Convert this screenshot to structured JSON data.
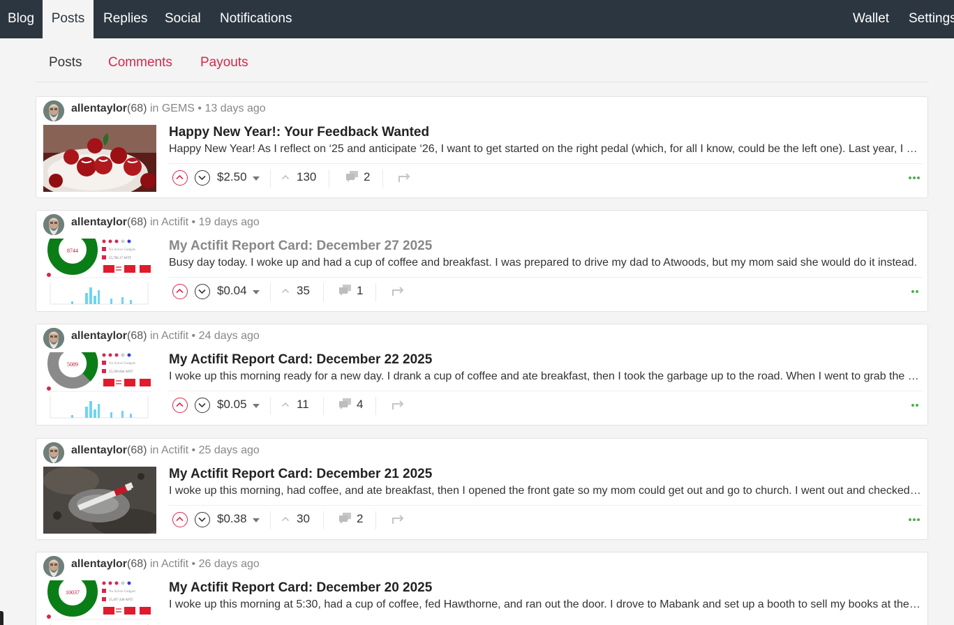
{
  "topnav": {
    "left": [
      "Blog",
      "Posts",
      "Replies",
      "Social",
      "Notifications"
    ],
    "right": [
      "Wallet",
      "Settings"
    ],
    "active": "Posts"
  },
  "subnav": {
    "tabs": [
      "Posts",
      "Comments",
      "Payouts"
    ],
    "active": "Posts"
  },
  "posts": [
    {
      "author": "allentaylor",
      "rep": "(68)",
      "in": "in",
      "community": "GEMS",
      "age": "13 days ago",
      "title": "Happy New Year!: Your Feedback Wanted",
      "excerpt": "Happy New Year! As I reflect on ‘25 and anticipate ‘26, I want to get started on the right pedal (which, for all I know, could be the left one). Last year, I had a lot of fun creating content and sharing it with you.",
      "payout": "$2.50",
      "votes": "130",
      "comments": "2",
      "thumb": "cherries",
      "visited": false
    },
    {
      "author": "allentaylor",
      "rep": "(68)",
      "in": "in",
      "community": "Actifit",
      "age": "19 days ago",
      "title": "My Actifit Report Card: December 27 2025",
      "excerpt": "Busy day today. I woke up and had a cup of coffee and breakfast. I was prepared to drive my dad to Atwoods, but my mom said she would do it instead.",
      "payout": "$0.04",
      "votes": "35",
      "comments": "1",
      "thumb": "actifit",
      "steps": "8744",
      "afit": "25,706.17 AFIT",
      "visited": true
    },
    {
      "author": "allentaylor",
      "rep": "(68)",
      "in": "in",
      "community": "Actifit",
      "age": "24 days ago",
      "title": "My Actifit Report Card: December 22 2025",
      "excerpt": "I woke up this morning ready for a new day. I drank a cup of coffee and ate breakfast, then I took the garbage up to the road. When I went to grab the mail, I noticed something.",
      "payout": "$0.05",
      "votes": "11",
      "comments": "4",
      "thumb": "actifit-grey",
      "steps": "5089",
      "afit": "25,596.684 AFIT",
      "visited": false
    },
    {
      "author": "allentaylor",
      "rep": "(68)",
      "in": "in",
      "community": "Actifit",
      "age": "25 days ago",
      "title": "My Actifit Report Card: December 21 2025",
      "excerpt": "I woke up this morning, had coffee, and ate breakfast, then I opened the front gate so my mom could get out and go to church. I went out and checked on the water line.",
      "payout": "$0.38",
      "votes": "30",
      "comments": "2",
      "thumb": "pipe",
      "visited": false
    },
    {
      "author": "allentaylor",
      "rep": "(68)",
      "in": "in",
      "community": "Actifit",
      "age": "26 days ago",
      "title": "My Actifit Report Card: December 20 2025",
      "excerpt": "I woke up this morning at 5:30, had a cup of coffee, fed Hawthorne, and ran out the door. I drove to Mabank and set up a booth to sell my books at the market.",
      "payout": "",
      "votes": "",
      "comments": "",
      "thumb": "actifit",
      "steps": "10037",
      "afit": "25,497.448 AFIT",
      "visited": false
    }
  ],
  "actifit_labels": {
    "no_gadgets": "No Active Gadgets"
  },
  "colors": {
    "nav_bg": "#2c3640",
    "accent": "#d7274b",
    "more_dots": "#4caf50",
    "ring_green": "#0b7d17"
  }
}
